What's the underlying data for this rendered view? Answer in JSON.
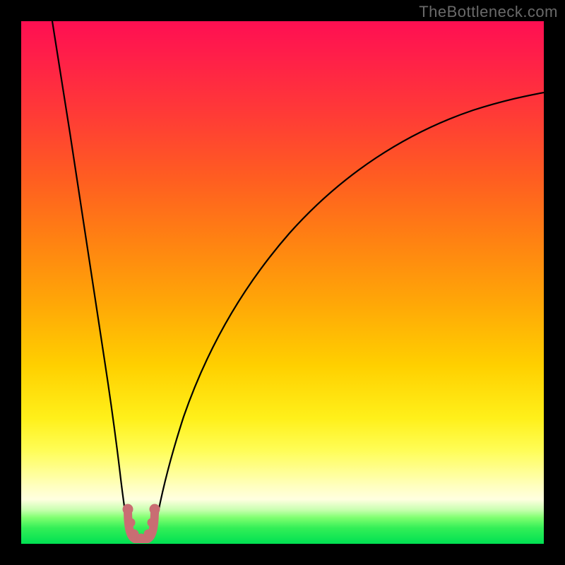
{
  "watermark": "TheBottleneck.com",
  "chart_data": {
    "type": "line",
    "title": "",
    "xlabel": "",
    "ylabel": "",
    "xlim": [
      0,
      100
    ],
    "ylim": [
      0,
      100
    ],
    "gradient_stops": [
      {
        "pct": 0,
        "color": "#ff0f52"
      },
      {
        "pct": 18,
        "color": "#ff3b36"
      },
      {
        "pct": 42,
        "color": "#ff8212"
      },
      {
        "pct": 66,
        "color": "#ffd000"
      },
      {
        "pct": 82,
        "color": "#fffd55"
      },
      {
        "pct": 93.5,
        "color": "#c8ffb0"
      },
      {
        "pct": 100,
        "color": "#00e052"
      }
    ],
    "series": [
      {
        "name": "bottleneck-curve-left",
        "x": [
          6,
          8,
          10,
          12,
          14,
          16,
          17.5,
          18.7
        ],
        "y": [
          100,
          80,
          60,
          43,
          28,
          15,
          7,
          1.5
        ]
      },
      {
        "name": "bottleneck-curve-right",
        "x": [
          23.8,
          25,
          27,
          30,
          35,
          42,
          52,
          65,
          80,
          95,
          100
        ],
        "y": [
          1.5,
          7,
          15,
          25,
          37,
          49,
          60,
          70,
          78,
          84,
          86
        ]
      },
      {
        "name": "marker-band",
        "note": "pink U-shaped marker at valley bottom",
        "x": [
          18.7,
          19.4,
          20.4,
          21.6,
          22.7,
          23.8
        ],
        "y": [
          7.5,
          3.0,
          1.8,
          1.8,
          3.0,
          7.5
        ]
      }
    ],
    "valley_x": 21.2
  }
}
